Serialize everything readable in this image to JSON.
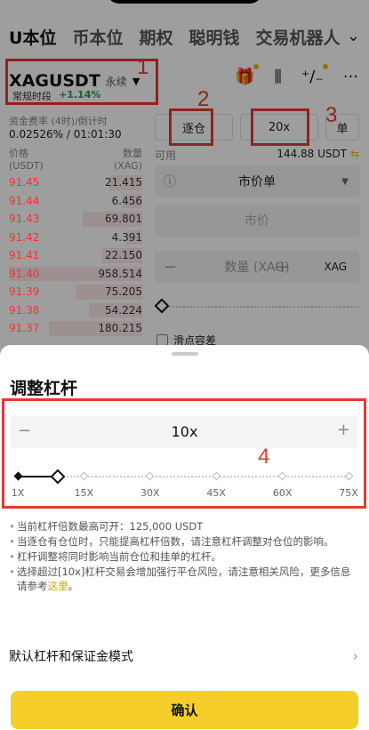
{
  "tabs": [
    "U本位",
    "币本位",
    "期权",
    "聪明钱",
    "交易机器人"
  ],
  "pair": {
    "name": "XAGUSDT",
    "type": "永续",
    "session": "常规时段",
    "change": "+1.14%"
  },
  "funding": {
    "label": "资金费率 (4时)/倒计时",
    "value": "0.02526% / 01:01:30"
  },
  "orderbook": {
    "price_header": "价格",
    "price_unit": "(USDT)",
    "qty_header": "数量",
    "qty_unit": "(XAG)",
    "rows": [
      {
        "price": "91.45",
        "qty": "21.415",
        "depth": 0.25
      },
      {
        "price": "91.44",
        "qty": "6.456",
        "depth": 0.15
      },
      {
        "price": "91.43",
        "qty": "69.801",
        "depth": 0.45
      },
      {
        "price": "91.42",
        "qty": "4.391",
        "depth": 0.12
      },
      {
        "price": "91.41",
        "qty": "22.150",
        "depth": 0.3
      },
      {
        "price": "91.40",
        "qty": "958.514",
        "depth": 1.0
      },
      {
        "price": "91.39",
        "qty": "75.205",
        "depth": 0.5
      },
      {
        "price": "91.38",
        "qty": "54.224",
        "depth": 0.4
      },
      {
        "price": "91.37",
        "qty": "180.215",
        "depth": 0.7
      }
    ]
  },
  "order_form": {
    "margin_mode": "逐仓",
    "leverage": "20x",
    "side_short": "单",
    "available_label": "可用",
    "available_value": "144.88 USDT",
    "order_type": "市价单",
    "price_placeholder": "市价",
    "qty_placeholder": "数量 (XAG)",
    "qty_unit": "XAG",
    "slippage_label": "滑点容差"
  },
  "annotations": [
    "1",
    "2",
    "3",
    "4"
  ],
  "sheet": {
    "title": "调整杠杆",
    "leverage_value": "10x",
    "minus": "−",
    "plus": "+",
    "slider_labels": [
      "1X",
      "15X",
      "30X",
      "45X",
      "60X",
      "75X"
    ],
    "slider_level": 0.12,
    "notes": [
      "当前杠杆倍数最高可开：125,000 USDT",
      "当逐仓有仓位时，只能提高杠杆倍数，请注意杠杆调整对仓位的影响。",
      "杠杆调整将同时影响当前仓位和挂单的杠杆。"
    ],
    "risk_note": "选择超过[10x]杠杆交易会增加强行平仓风险，请注意相关风险，更多信息请参考",
    "risk_link": "这里",
    "risk_end": "。",
    "default_mode": "默认杠杆和保证金模式",
    "confirm": "确认"
  },
  "colors": {
    "accent": "#f0b90b",
    "red": "#e53935",
    "green": "#1aa05a"
  }
}
